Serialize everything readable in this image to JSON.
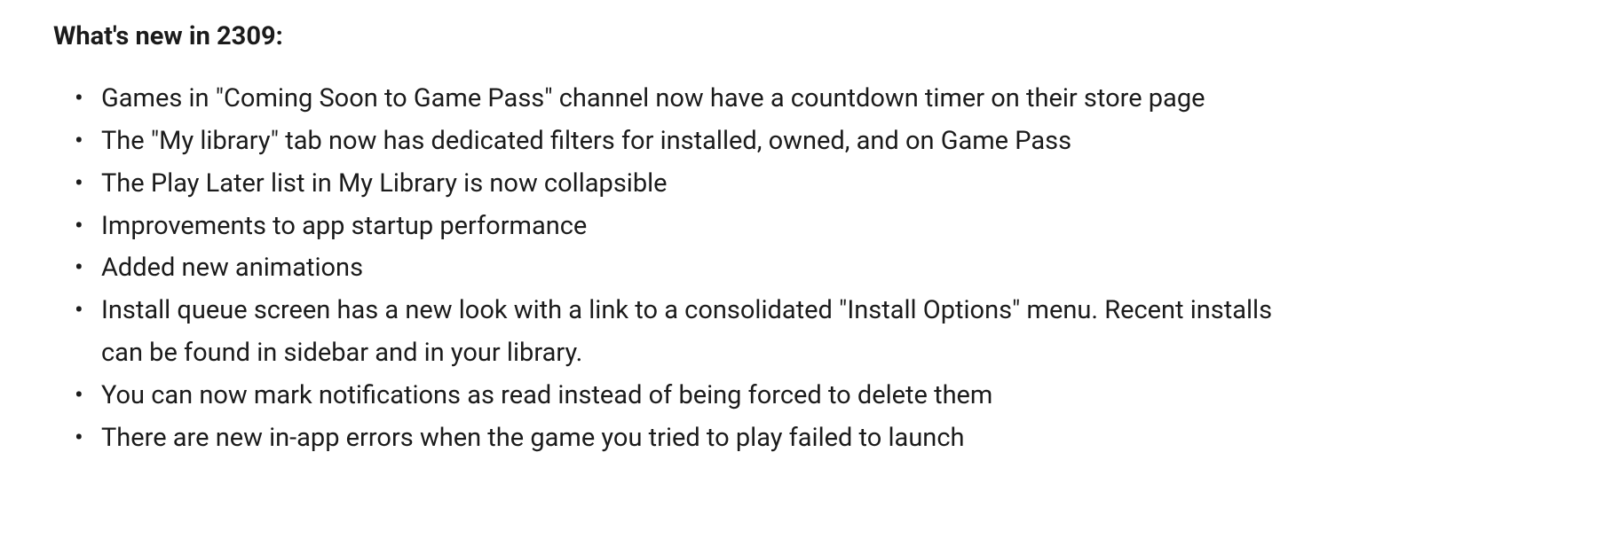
{
  "heading": "What's new in 2309:",
  "items": [
    "Games in \"Coming Soon to Game Pass\" channel now have a countdown timer on their store page",
    "The \"My library\" tab now has dedicated filters for installed, owned, and on Game Pass",
    "The Play Later list in My Library is now collapsible",
    "Improvements to app startup performance",
    "Added new animations",
    "Install queue screen has a new look with a link to a consolidated \"Install Options\" menu. Recent installs can be found in sidebar and in your library.",
    "You can now mark notifications as read instead of being forced to delete them",
    "There are new in-app errors when the game you tried to play failed to launch"
  ]
}
